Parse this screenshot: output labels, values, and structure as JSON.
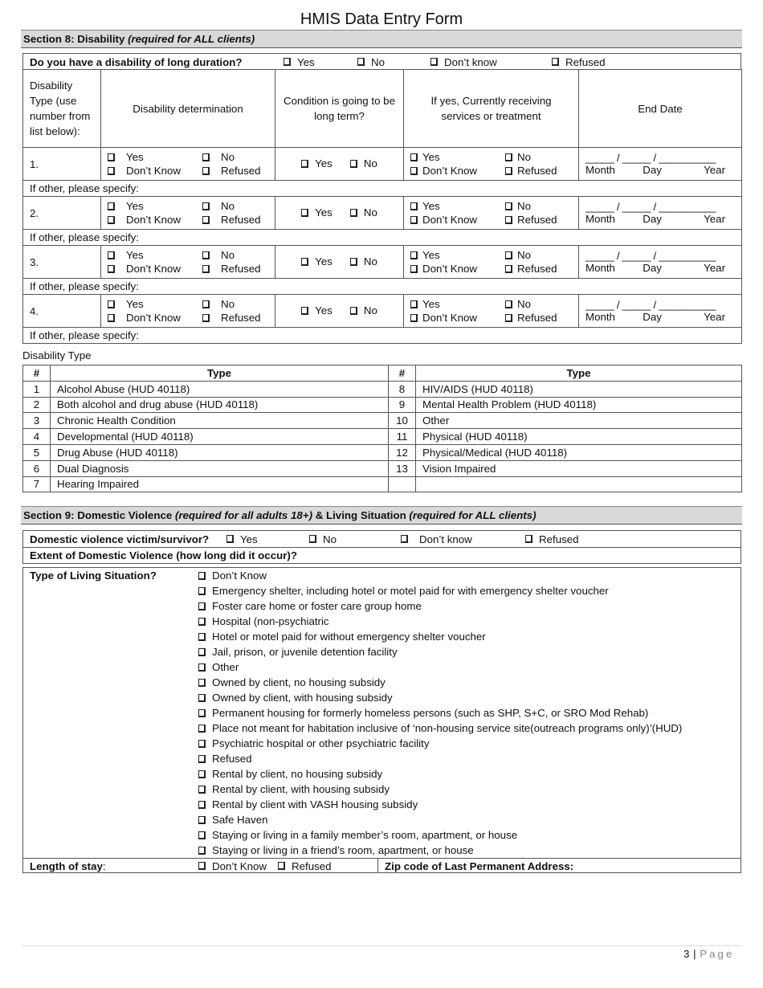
{
  "title": "HMIS Data Entry Form",
  "section8": {
    "heading": "Section 8: Disability ",
    "heading_note": "(required for ALL clients)",
    "question": "Do you have a disability of long duration?",
    "question_options": [
      "Yes",
      "No",
      "Don’t know",
      "Refused"
    ],
    "columns": {
      "type": "Disability Type (use number from list below):",
      "determination": "Disability determination",
      "long_term": "Condition is going to be long term?",
      "services": "If yes, Currently receiving services or treatment",
      "end_date": "End Date"
    },
    "rows": [
      {
        "num": "1.",
        "specify": "If other, please specify:"
      },
      {
        "num": "2.",
        "specify": "If other, please specify:"
      },
      {
        "num": "3.",
        "specify": "If other, please specify:"
      },
      {
        "num": "4.",
        "specify": "If other, please specify:"
      }
    ],
    "determination_options": [
      "Yes",
      "No",
      "Don’t Know",
      "Refused"
    ],
    "long_term_options": [
      "Yes",
      "No"
    ],
    "services_options": [
      "Yes",
      "No",
      "Don’t Know",
      "Refused"
    ],
    "date_blank": "_____ / _____ / __________",
    "date_labels": [
      "Month",
      "Day",
      "Year"
    ]
  },
  "disability_types": {
    "label": "Disability Type",
    "headers": [
      "#",
      "Type",
      "#",
      "Type"
    ],
    "left": [
      {
        "num": "1",
        "type": "Alcohol Abuse (HUD 40118)"
      },
      {
        "num": "2",
        "type": "Both alcohol and drug abuse (HUD 40118)"
      },
      {
        "num": "3",
        "type": "Chronic Health Condition"
      },
      {
        "num": "4",
        "type": "Developmental (HUD 40118)"
      },
      {
        "num": "5",
        "type": "Drug Abuse (HUD 40118)"
      },
      {
        "num": "6",
        "type": "Dual Diagnosis"
      },
      {
        "num": "7",
        "type": "Hearing Impaired"
      }
    ],
    "right": [
      {
        "num": "8",
        "type": "HIV/AIDS (HUD 40118)"
      },
      {
        "num": "9",
        "type": "Mental Health Problem (HUD 40118)"
      },
      {
        "num": "10",
        "type": "Other"
      },
      {
        "num": "11",
        "type": "Physical (HUD 40118)"
      },
      {
        "num": "12",
        "type": "Physical/Medical (HUD 40118)"
      },
      {
        "num": "13",
        "type": "Vision Impaired"
      },
      {
        "num": "",
        "type": ""
      }
    ]
  },
  "section9": {
    "heading_a": "Section 9: Domestic Violence ",
    "heading_a_note": "(required for all adults 18+)",
    "heading_b": " & Living Situation ",
    "heading_b_note": "(required for ALL clients)",
    "dv_question": "Domestic violence victim/survivor?",
    "dv_options": [
      "Yes",
      "No",
      "Don’t know",
      "Refused"
    ],
    "dv_extent": "Extent of Domestic Violence (how long did it occur)?",
    "living_label": "Type of Living Situation?",
    "living_options": [
      "Don’t Know",
      "Emergency shelter, including hotel or motel paid for with emergency shelter voucher",
      "Foster care home or foster care group home",
      "Hospital (non-psychiatric",
      "Hotel or motel paid for without emergency shelter voucher",
      "Jail, prison, or juvenile detention facility",
      "Other",
      "Owned by client, no housing subsidy",
      "Owned by client, with housing subsidy",
      "Permanent housing for formerly homeless persons (such as SHP, S+C, or SRO Mod Rehab)",
      "Place not meant for habitation inclusive of ‘non-housing service site(outreach programs only)’(HUD)",
      "Psychiatric hospital or other psychiatric facility",
      "Refused",
      "Rental by client, no housing subsidy",
      "Rental by client, with housing subsidy",
      "Rental by client with VASH housing subsidy",
      "Safe Haven",
      "Staying or living in a family member’s room, apartment, or house",
      "Staying or living in a friend’s room, apartment, or house"
    ],
    "length_label": "Length of stay",
    "length_colon": ":",
    "length_options": [
      "Don’t Know",
      "Refused"
    ],
    "zip_label": "Zip code of  Last Permanent Address:"
  },
  "footer": {
    "page_number": "3",
    "separator": " | ",
    "page_word": "Page"
  }
}
